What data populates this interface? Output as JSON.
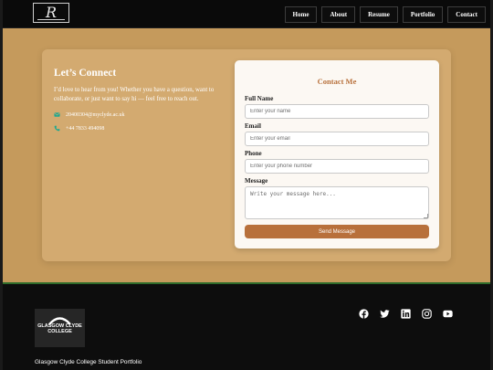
{
  "header": {
    "logo_letter": "R",
    "nav": [
      "Home",
      "About",
      "Resume",
      "Portfolio",
      "Contact"
    ]
  },
  "connect": {
    "title": "Let’s Connect",
    "text": "I’d love to hear from you! Whether you have a question, want to collaborate, or just want to say hi — feel free to reach out.",
    "email": "20400304@myclyde.ac.uk",
    "phone": "+44 7833 494098"
  },
  "form": {
    "title": "Contact Me",
    "name_label": "Full Name",
    "name_placeholder": "Enter your name",
    "email_label": "Email",
    "email_placeholder": "Enter your email",
    "phone_label": "Phone",
    "phone_placeholder": "Enter your phone number",
    "message_label": "Message",
    "message_placeholder": "Write your message here...",
    "submit": "Send Message"
  },
  "footer": {
    "college_logo_text": "GLASGOW CLYDE COLLEGE",
    "socials": [
      "facebook-icon",
      "twitter-icon",
      "linkedin-icon",
      "instagram-icon",
      "youtube-icon"
    ],
    "copyright": "Glasgow Clyde College Student Portfolio"
  },
  "colors": {
    "page_bg": "#c59a5c",
    "panel_bg": "#d3aa70",
    "accent": "#b8703b",
    "icon_teal": "#1fa88f",
    "footer_bg": "#0d0d0d",
    "footer_rule": "#2e6b2a"
  }
}
